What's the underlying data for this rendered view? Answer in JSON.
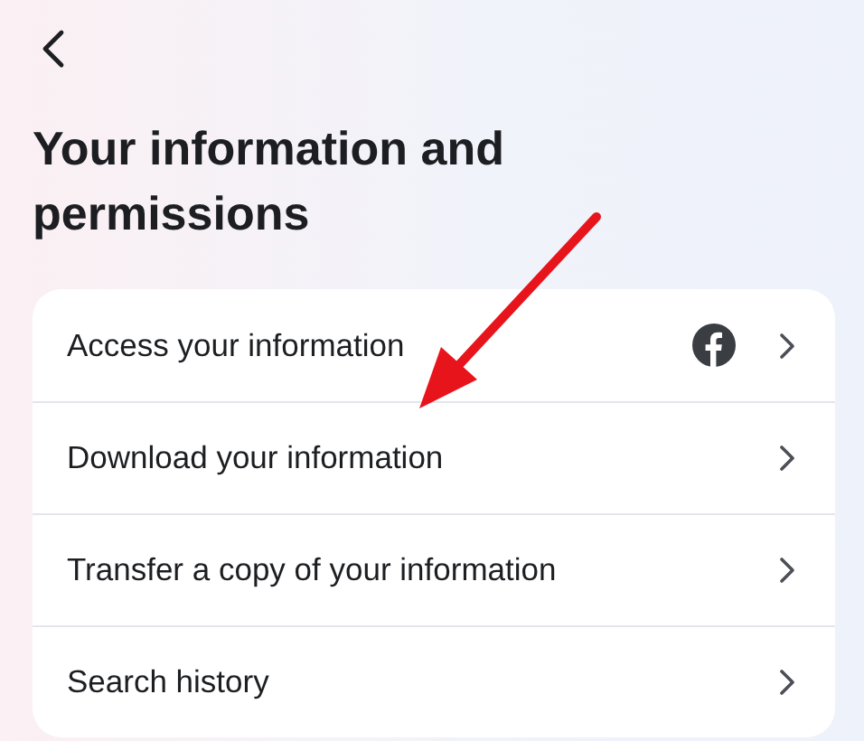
{
  "title": "Your information and permissions",
  "rows": [
    {
      "label": "Access your information",
      "kind": "linked"
    },
    {
      "label": "Download your information",
      "kind": "plain"
    },
    {
      "label": "Transfer a copy of your information",
      "kind": "plain"
    },
    {
      "label": "Search history",
      "kind": "plain"
    }
  ]
}
